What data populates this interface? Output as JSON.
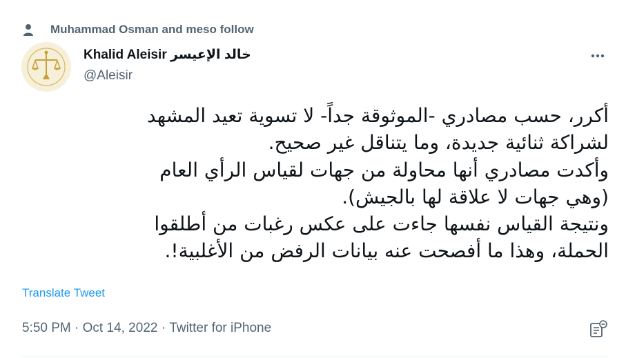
{
  "social_context": {
    "icon": "person-icon",
    "text": "Muhammad Osman and meso follow"
  },
  "author": {
    "avatar_icon": "scales-of-justice-logo",
    "display_name": "Khalid Aleisir خالد الإعيسر",
    "handle": "@Aleisir"
  },
  "more_icon": "more-horizontal-icon",
  "tweet": {
    "lines": [
      "أكرر، حسب مصادري -الموثوقة جداً- لا تسوية تعيد المشهد",
      "لشراكة ثنائية جديدة، وما يتناقل غير صحيح.",
      "وأكدت مصادري أنها محاولة من جهات لقياس الرأي العام",
      "(وهي جهات لا علاقة لها بالجيش).",
      "ونتيجة القياس نفسها جاءت على عكس رغبات من أطلقوا",
      "الحملة، وهذا ما أفصحت عنه بيانات الرفض من الأغلبية!."
    ],
    "translate_label": "Translate Tweet"
  },
  "meta": {
    "time": "5:50 PM",
    "separator": " · ",
    "date": "Oct 14, 2022",
    "source": "Twitter for iPhone",
    "analytics_icon": "tweet-analytics-icon"
  },
  "colors": {
    "text_primary": "#0f1419",
    "text_secondary": "#536471",
    "link": "#1d9bf0",
    "divider": "#eff3f4"
  }
}
